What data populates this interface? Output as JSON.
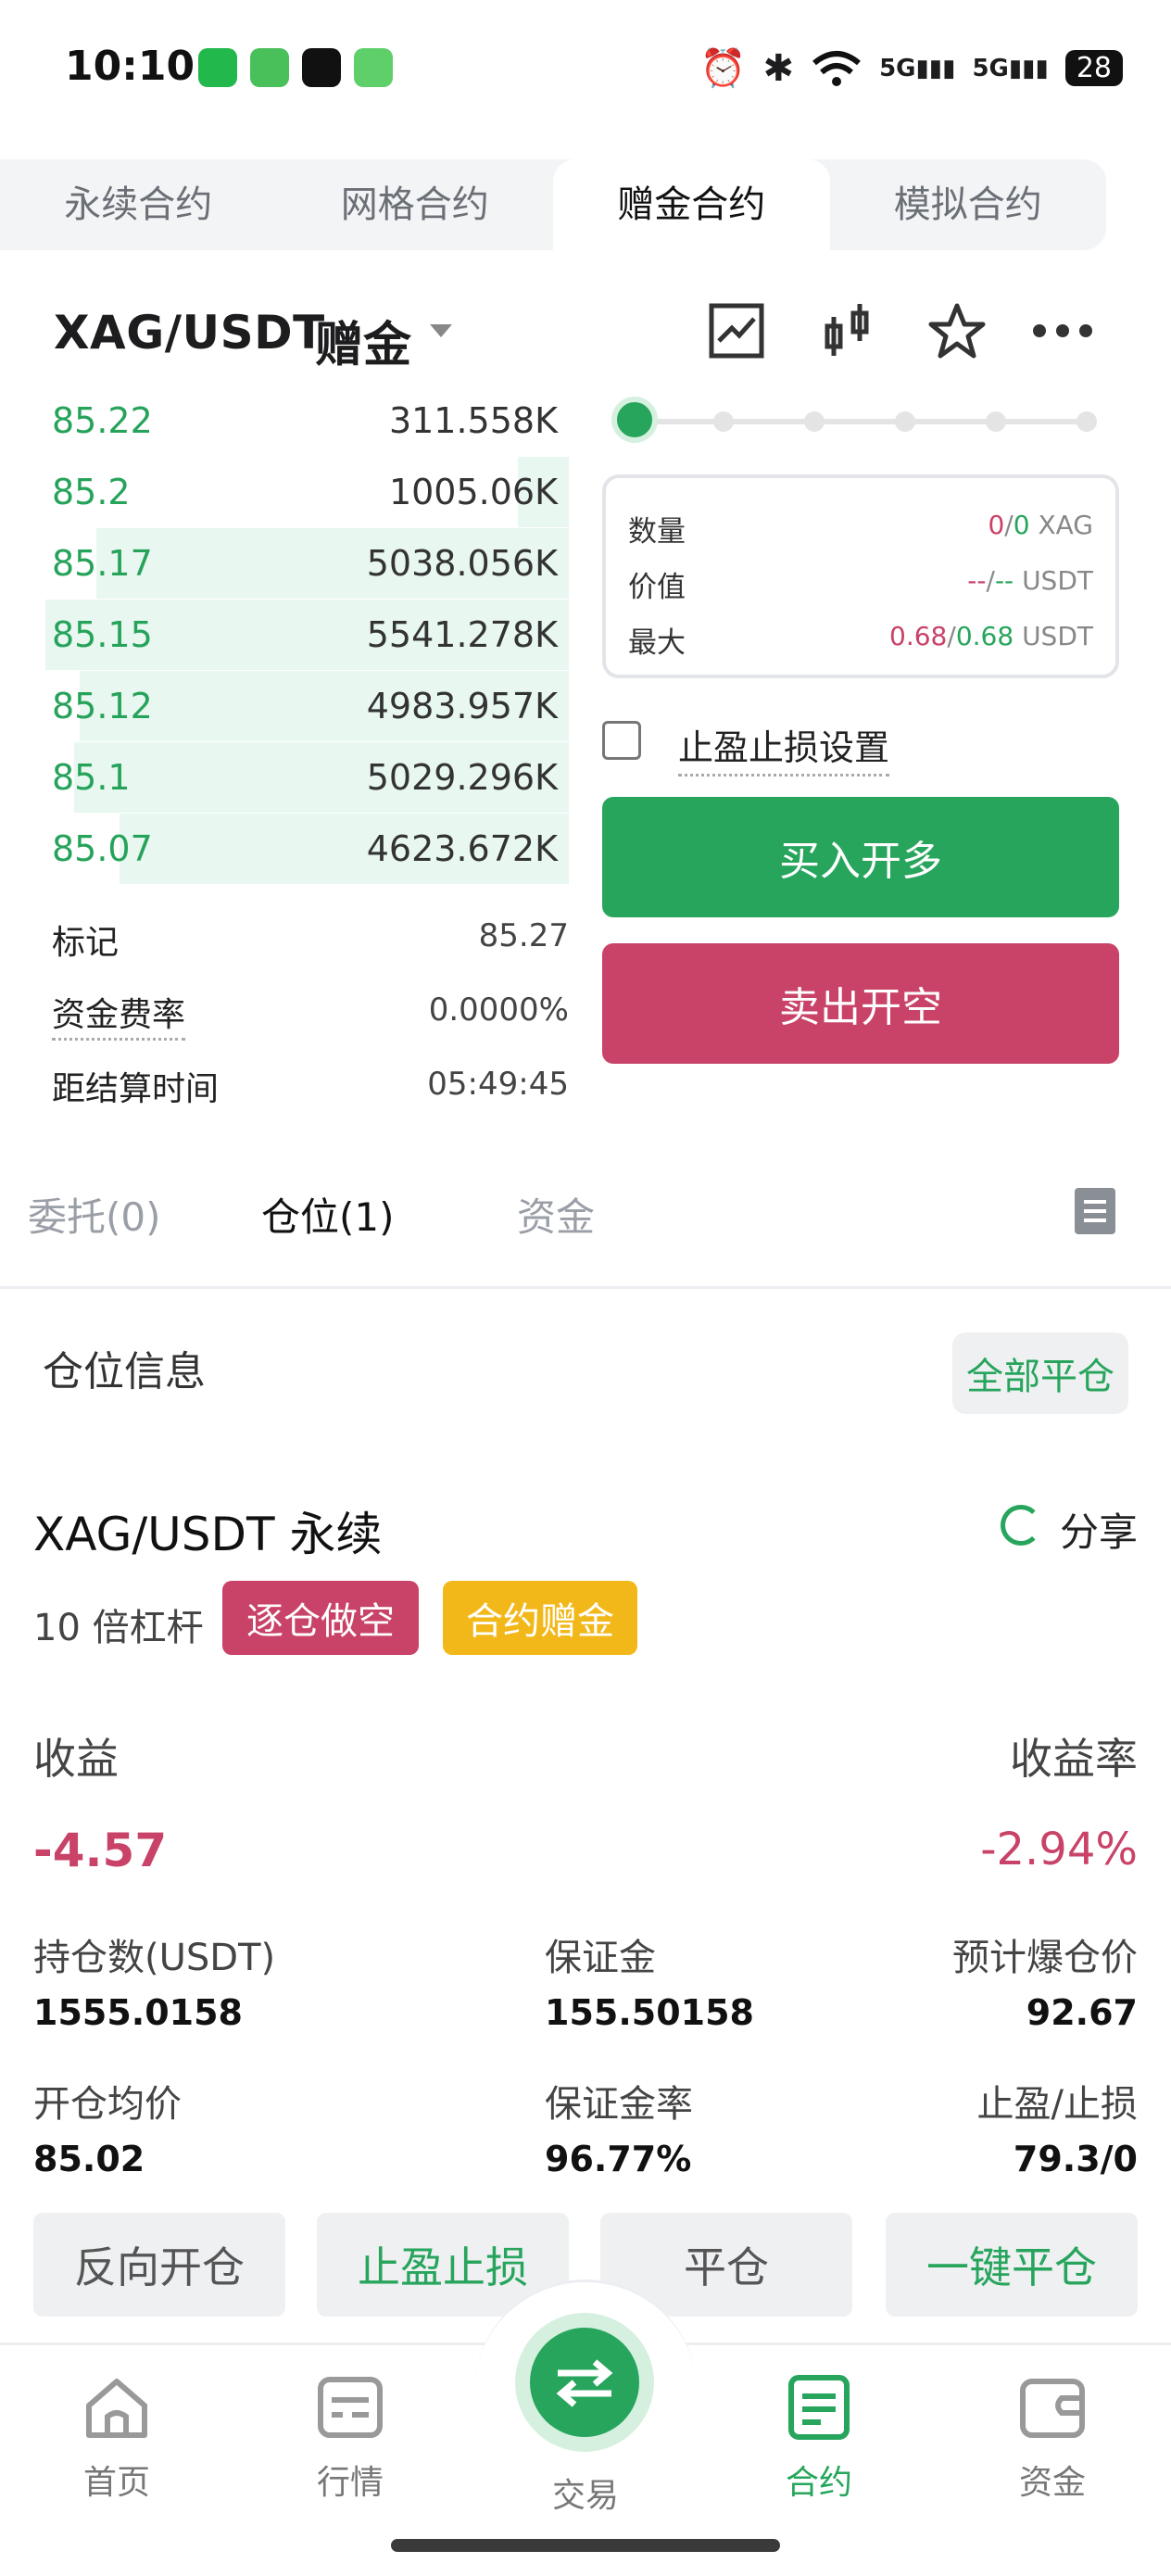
{
  "status_bar": {
    "time": "10:10",
    "battery": "28",
    "network": [
      "5G",
      "5G"
    ]
  },
  "tabs": [
    {
      "label": "永续合约",
      "active": false
    },
    {
      "label": "网格合约",
      "active": false
    },
    {
      "label": "赠金合约",
      "active": true
    },
    {
      "label": "模拟合约",
      "active": false
    }
  ],
  "pair_header": {
    "pair": "XAG/USDT",
    "tag": "赠金"
  },
  "order_book": {
    "rows": [
      {
        "price": "85.22",
        "qty": "311.558K",
        "depth": 0.0
      },
      {
        "price": "85.2",
        "qty": "1005.06K",
        "depth": 0.09
      },
      {
        "price": "85.17",
        "qty": "5038.056K",
        "depth": 0.83
      },
      {
        "price": "85.15",
        "qty": "5541.278K",
        "depth": 0.92
      },
      {
        "price": "85.12",
        "qty": "4983.957K",
        "depth": 0.86
      },
      {
        "price": "85.1",
        "qty": "5029.296K",
        "depth": 0.87
      },
      {
        "price": "85.07",
        "qty": "4623.672K",
        "depth": 0.79
      }
    ],
    "mark_label": "标记",
    "mark_value": "85.27",
    "funding_label": "资金费率",
    "funding_value": "0.0000%",
    "settle_label": "距结算时间",
    "settle_value": "05:49:45"
  },
  "order_panel": {
    "leverage_slider": 0.0,
    "qty_label": "数量",
    "qty_red": "0",
    "qty_green": "0",
    "qty_unit": "XAG",
    "value_label": "价值",
    "value_red": "--",
    "value_green": "--",
    "value_unit": "USDT",
    "max_label": "最大",
    "max_red": "0.68",
    "max_green": "0.68",
    "max_unit": "USDT",
    "tpsl_label": "止盈止损设置",
    "buy_label": "买入开多",
    "sell_label": "卖出开空",
    "slash": "/"
  },
  "sub_tabs": [
    {
      "label": "委托(0)",
      "active": false
    },
    {
      "label": "仓位(1)",
      "active": true
    },
    {
      "label": "资金",
      "active": false
    }
  ],
  "positions": {
    "title": "仓位信息",
    "close_all": "全部平仓",
    "pair": "XAG/USDT 永续",
    "share": "分享",
    "leverage": "10 倍杠杆",
    "badge_mode": "逐仓做空",
    "badge_bonus": "合约赠金",
    "pnl_label": "收益",
    "pnl_rate_label": "收益率",
    "pnl_value": "-4.57",
    "pnl_rate_value": "-2.94%",
    "size_label": "持仓数(USDT)",
    "size_value": "1555.0158",
    "margin_label": "保证金",
    "margin_value": "155.50158",
    "liq_label": "预计爆仓价",
    "liq_value": "92.67",
    "entry_label": "开仓均价",
    "entry_value": "85.02",
    "margin_rate_label": "保证金率",
    "margin_rate_value": "96.77%",
    "tpsl_label": "止盈/止损",
    "tpsl_value": "79.3/0"
  },
  "actions": [
    "反向开仓",
    "止盈止损",
    "平仓",
    "一键平仓"
  ],
  "bottom_nav": [
    {
      "label": "首页",
      "icon": "home-icon"
    },
    {
      "label": "行情",
      "icon": "market-icon"
    },
    {
      "label": "交易",
      "icon": "swap-icon"
    },
    {
      "label": "合约",
      "icon": "contract-icon",
      "active": true
    },
    {
      "label": "资金",
      "icon": "wallet-icon"
    }
  ],
  "colors": {
    "green": "#27a55c",
    "red": "#c94267",
    "yellow": "#f2b81a"
  }
}
